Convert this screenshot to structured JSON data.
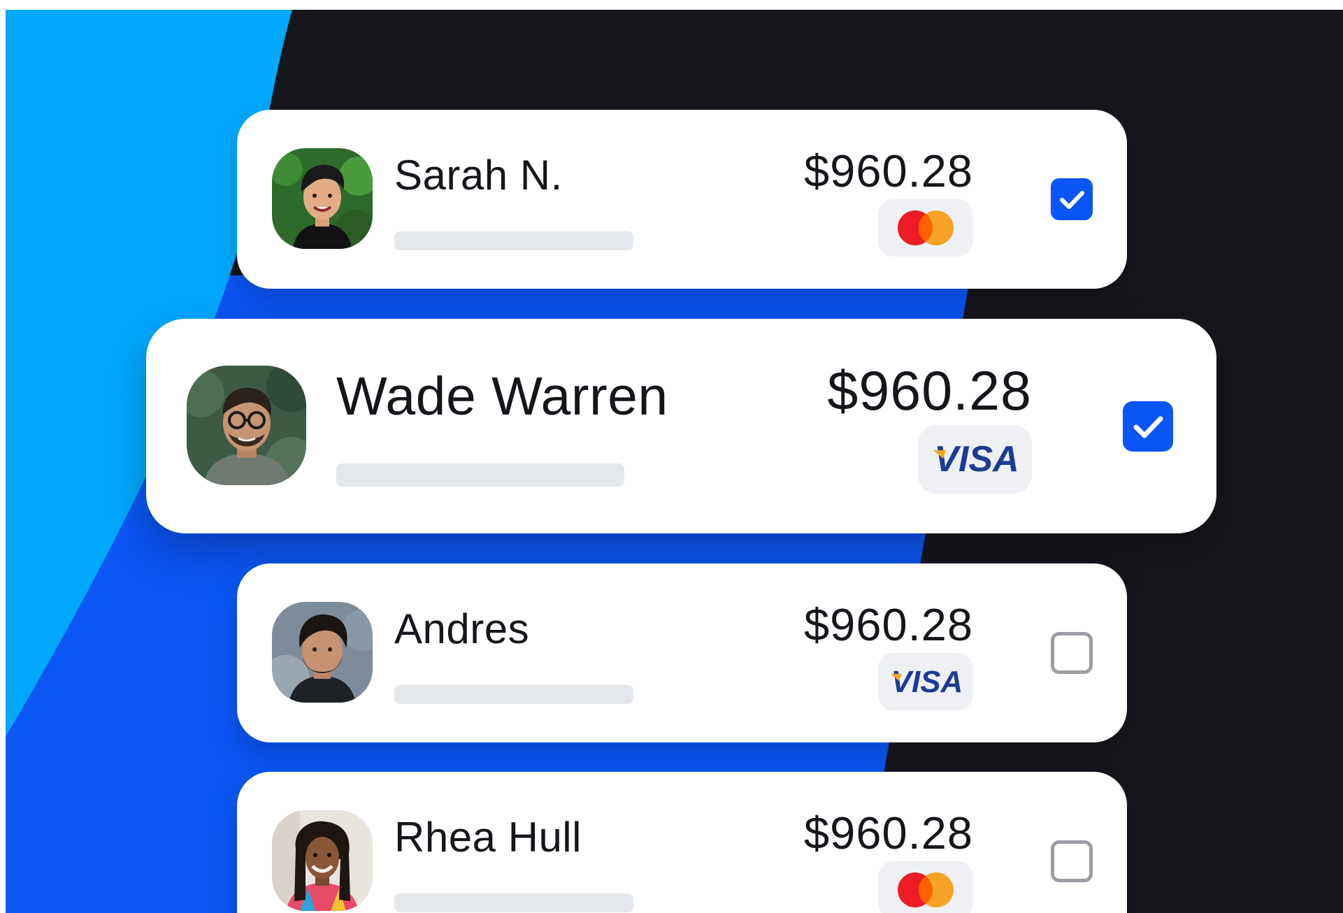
{
  "colors": {
    "page_background": "#ffffff",
    "dark_background": "#15171d",
    "light_blue": "#00a8ff",
    "royal_blue": "#0b56f5",
    "card_background": "#ffffff",
    "checkbox_checked": "#0a55f5",
    "checkbox_unchecked_border": "#9a9da3",
    "placeholder_bar": "#e4e7eb",
    "badge_background": "#eef0f3",
    "mastercard_red": "#eb1c24",
    "mastercard_orange": "#f79e1b",
    "visa_blue": "#1a3c93",
    "visa_gold": "#f6a623"
  },
  "transactions": [
    {
      "name": "Sarah N.",
      "amount": "$960.28",
      "payment_method": "mastercard",
      "selected": true,
      "avatar_icon": "person-avatar"
    },
    {
      "name": "Wade Warren",
      "amount": "$960.28",
      "payment_method": "visa",
      "payment_label": "VISA",
      "selected": true,
      "avatar_icon": "person-avatar"
    },
    {
      "name": "Andres",
      "amount": "$960.28",
      "payment_method": "visa",
      "payment_label": "VISA",
      "selected": false,
      "avatar_icon": "person-avatar"
    },
    {
      "name": "Rhea Hull",
      "amount": "$960.28",
      "payment_method": "mastercard",
      "selected": false,
      "avatar_icon": "person-avatar"
    }
  ]
}
